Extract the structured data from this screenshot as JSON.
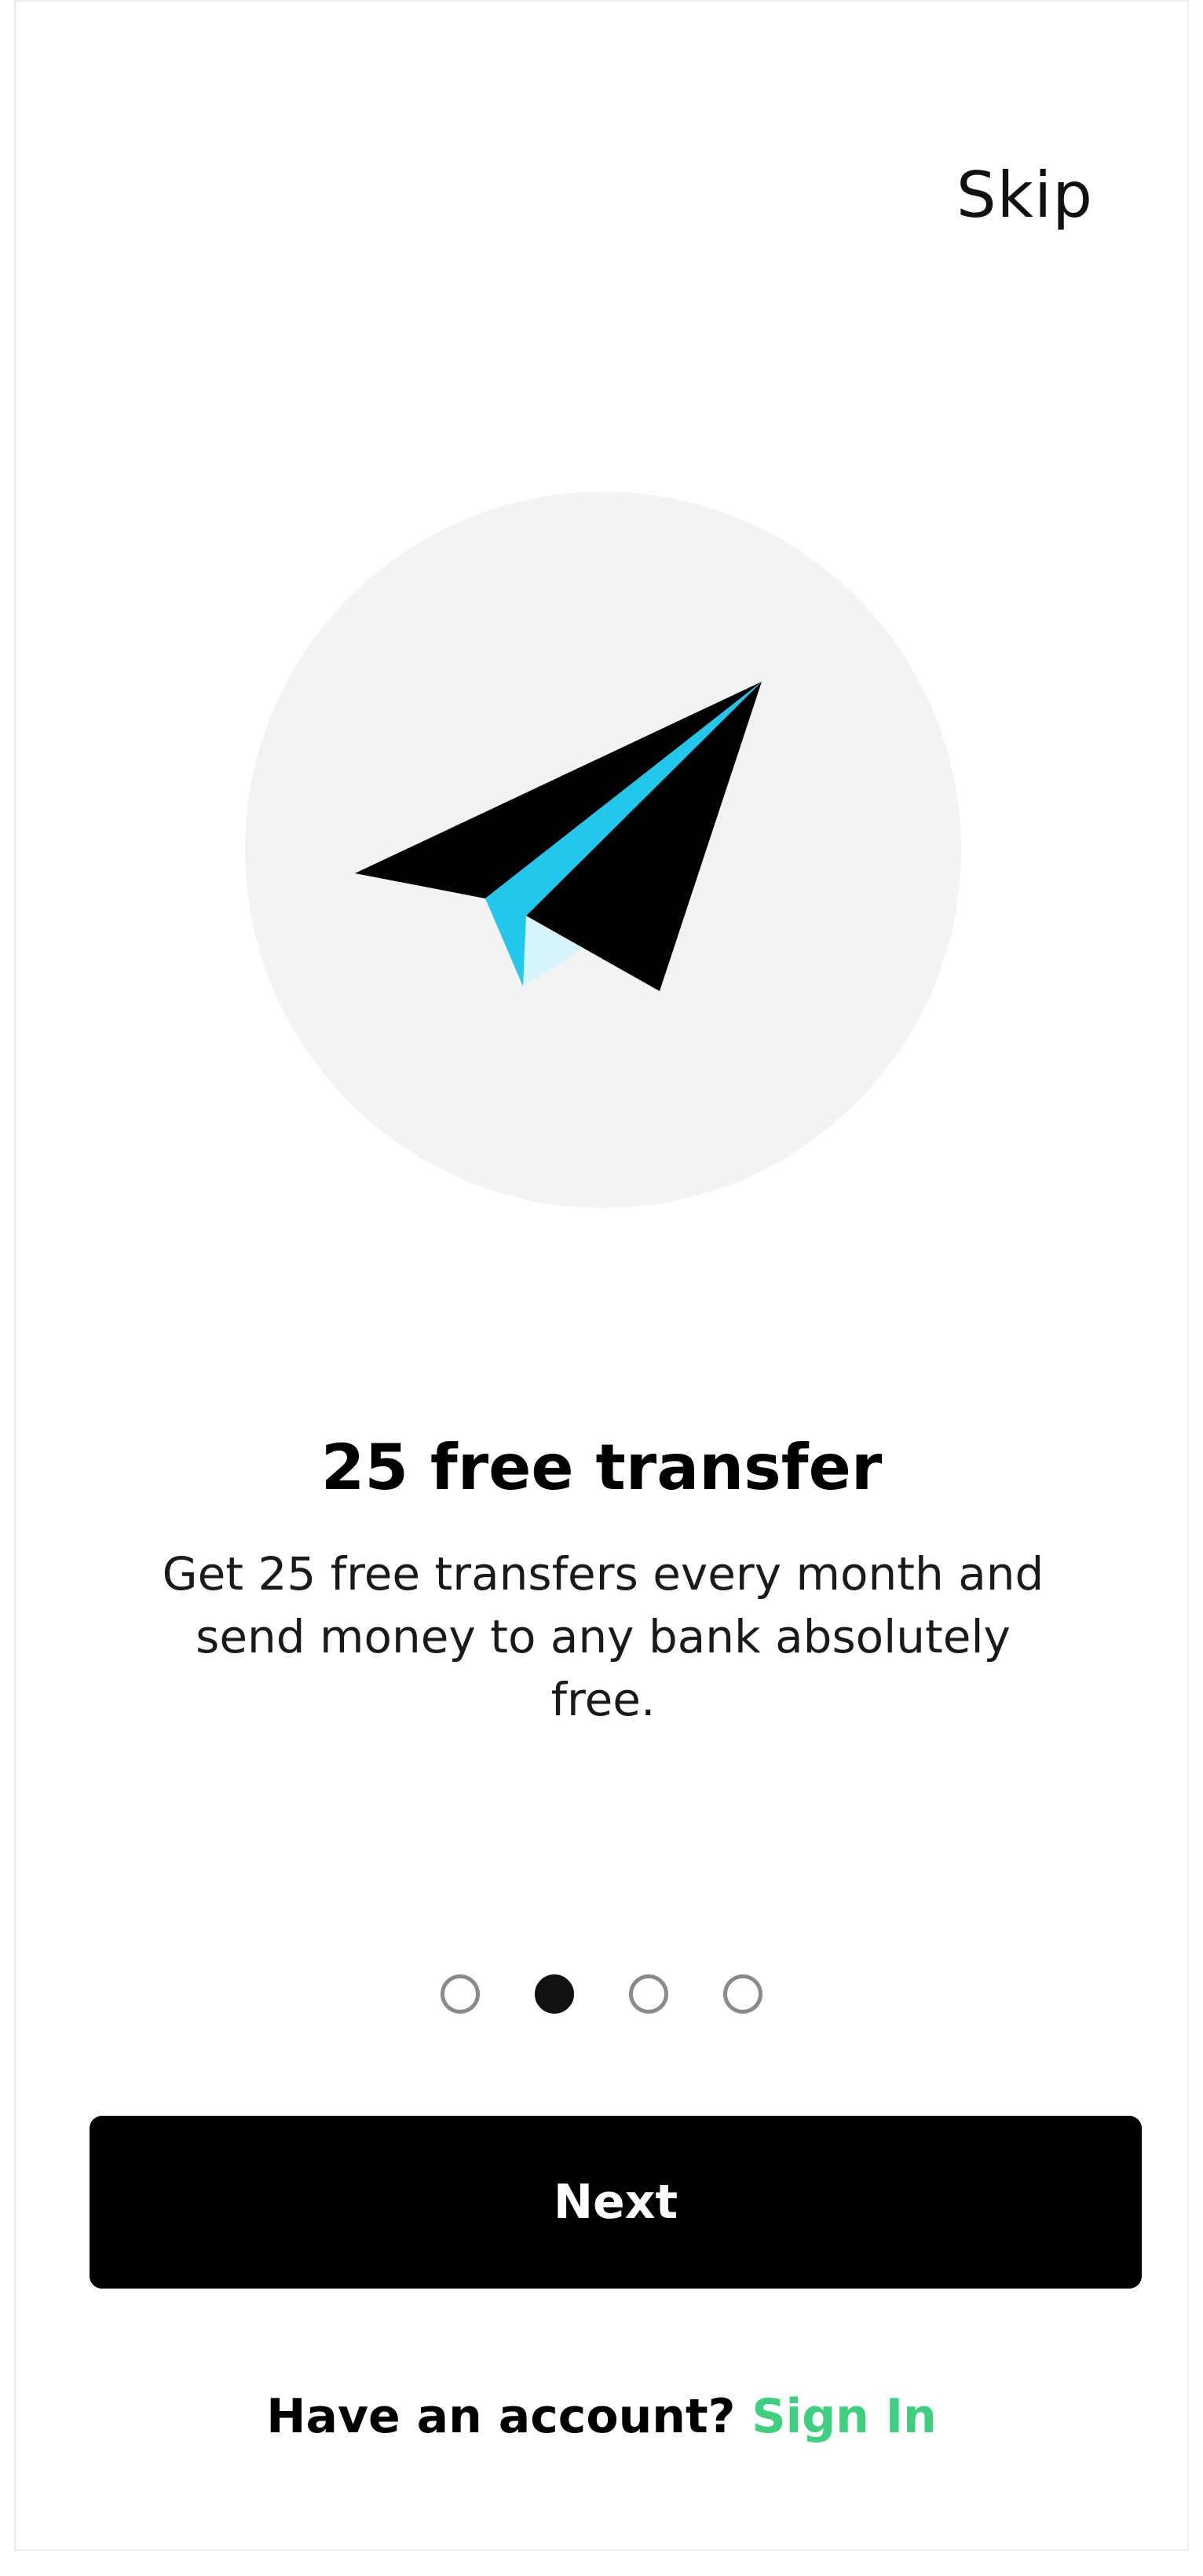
{
  "header": {
    "skip_label": "Skip"
  },
  "hero": {
    "icon": "paper-plane-icon"
  },
  "content": {
    "title": "25 free transfer",
    "description": "Get 25 free transfers every month and send money to any bank absolutely free."
  },
  "pagination": {
    "total": 4,
    "active_index": 1
  },
  "actions": {
    "next_label": "Next",
    "account_prompt": "Have an account?",
    "signin_label": "Sign In"
  },
  "colors": {
    "accent_green": "#3ecf7f",
    "plane_blue": "#22c8ec",
    "plane_light": "#d6f6fb",
    "button_bg": "#000000"
  }
}
